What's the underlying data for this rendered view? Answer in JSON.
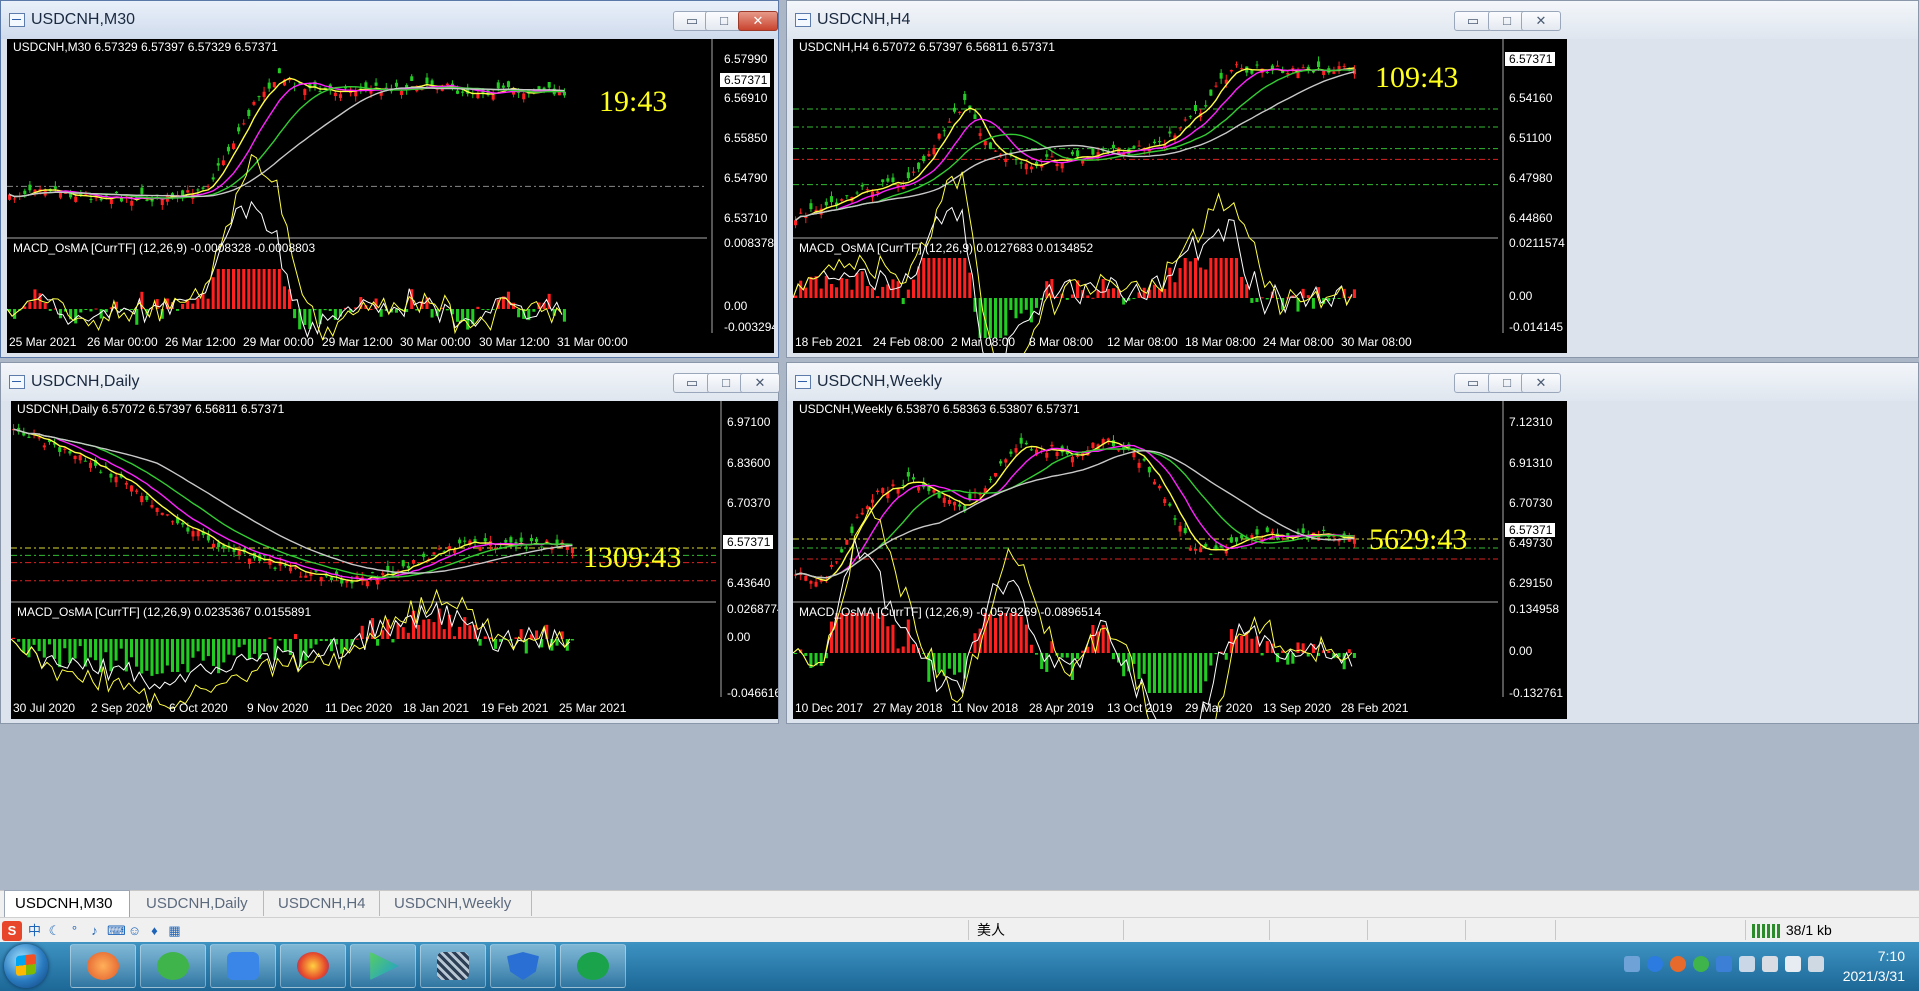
{
  "windows": [
    {
      "id": "m30",
      "title": "USDCNH,M30",
      "active": true,
      "header": "USDCNH,M30  6.57329 6.57397 6.57329 6.57371",
      "price_ticks": [
        "6.57990",
        "6.56910",
        "6.55850",
        "6.54790",
        "6.53710"
      ],
      "current_price": "6.57371",
      "timer": "19:43",
      "indicator": "MACD_OsMA [CurrTF] (12,26,9) -0.0008328 -0.0008803",
      "ind_ticks": [
        "0.0083784",
        "0.00",
        "-0.003294"
      ],
      "date_ticks": [
        "25 Mar 2021",
        "26 Mar 00:00",
        "26 Mar 12:00",
        "29 Mar 00:00",
        "29 Mar 12:00",
        "30 Mar 00:00",
        "30 Mar 12:00",
        "31 Mar 00:00"
      ]
    },
    {
      "id": "h4",
      "title": "USDCNH,H4",
      "active": false,
      "header": "USDCNH,H4  6.57072 6.57397 6.56811 6.57371",
      "price_ticks": [
        "6.57371",
        "6.54160",
        "6.51100",
        "6.47980",
        "6.44860"
      ],
      "current_price": "6.57371",
      "timer": "109:43",
      "indicator": "MACD_OsMA [CurrTF] (12,26,9) 0.0127683 0.0134852",
      "ind_ticks": [
        "0.0211574",
        "0.00",
        "-0.014145"
      ],
      "date_ticks": [
        "18 Feb 2021",
        "24 Feb 08:00",
        "2 Mar 08:00",
        "8 Mar 08:00",
        "12 Mar 08:00",
        "18 Mar 08:00",
        "24 Mar 08:00",
        "30 Mar 08:00"
      ]
    },
    {
      "id": "daily",
      "title": "USDCNH,Daily",
      "active": false,
      "header": "USDCNH,Daily  6.57072 6.57397 6.56811 6.57371",
      "price_ticks": [
        "6.97100",
        "6.83600",
        "6.70370",
        "6.57371",
        "6.43640"
      ],
      "current_price": "6.57371",
      "timer": "1309:43",
      "indicator": "MACD_OsMA [CurrTF] (12,26,9) 0.0235367 0.0155891",
      "ind_ticks": [
        "0.0268774",
        "0.00",
        "-0.0466169"
      ],
      "date_ticks": [
        "30 Jul 2020",
        "2 Sep 2020",
        "6 Oct 2020",
        "9 Nov 2020",
        "11 Dec 2020",
        "18 Jan 2021",
        "19 Feb 2021",
        "25 Mar 2021"
      ]
    },
    {
      "id": "weekly",
      "title": "USDCNH,Weekly",
      "active": false,
      "header": "USDCNH,Weekly  6.53870 6.58363 6.53807 6.57371",
      "price_ticks": [
        "7.12310",
        "6.91310",
        "6.70730",
        "6.57371",
        "6.49730",
        "6.29150"
      ],
      "current_price": "6.57371",
      "timer": "5629:43",
      "indicator": "MACD_OsMA [CurrTF] (12,26,9) -0.0579269 -0.0896514",
      "ind_ticks": [
        "0.134958",
        "0.00",
        "-0.132761"
      ],
      "date_ticks": [
        "10 Dec 2017",
        "27 May 2018",
        "11 Nov 2018",
        "28 Apr 2019",
        "13 Oct 2019",
        "29 Mar 2020",
        "13 Sep 2020",
        "28 Feb 2021"
      ]
    }
  ],
  "window_buttons": {
    "minimize": "▭",
    "maximize": "□",
    "close": "✕"
  },
  "tabs": [
    "USDCNH,M30",
    "USDCNH,Daily",
    "USDCNH,H4",
    "USDCNH,Weekly"
  ],
  "active_tab": "USDCNH,M30",
  "status": {
    "profile": "美人",
    "traffic": "38/1 kb"
  },
  "ime": {
    "logo": "S",
    "mode": "中"
  },
  "taskbar": {
    "apps": [
      "firefox-like-icon",
      "wechat-icon",
      "feishu-icon",
      "firefox-icon",
      "media-player-icon",
      "qr-tool-icon",
      "shield-app-icon",
      "green-app-icon"
    ]
  },
  "clock": {
    "time": "7:10",
    "date": "2021/3/31"
  },
  "colors": {
    "bull": "#ff2020",
    "bear": "#22cc22",
    "ma_fast": "#ffff44",
    "ma_mid": "#ff22ff",
    "ma_slow": "#33cc33",
    "ma_long": "#c8c8c8",
    "timer": "#ffff1c"
  }
}
